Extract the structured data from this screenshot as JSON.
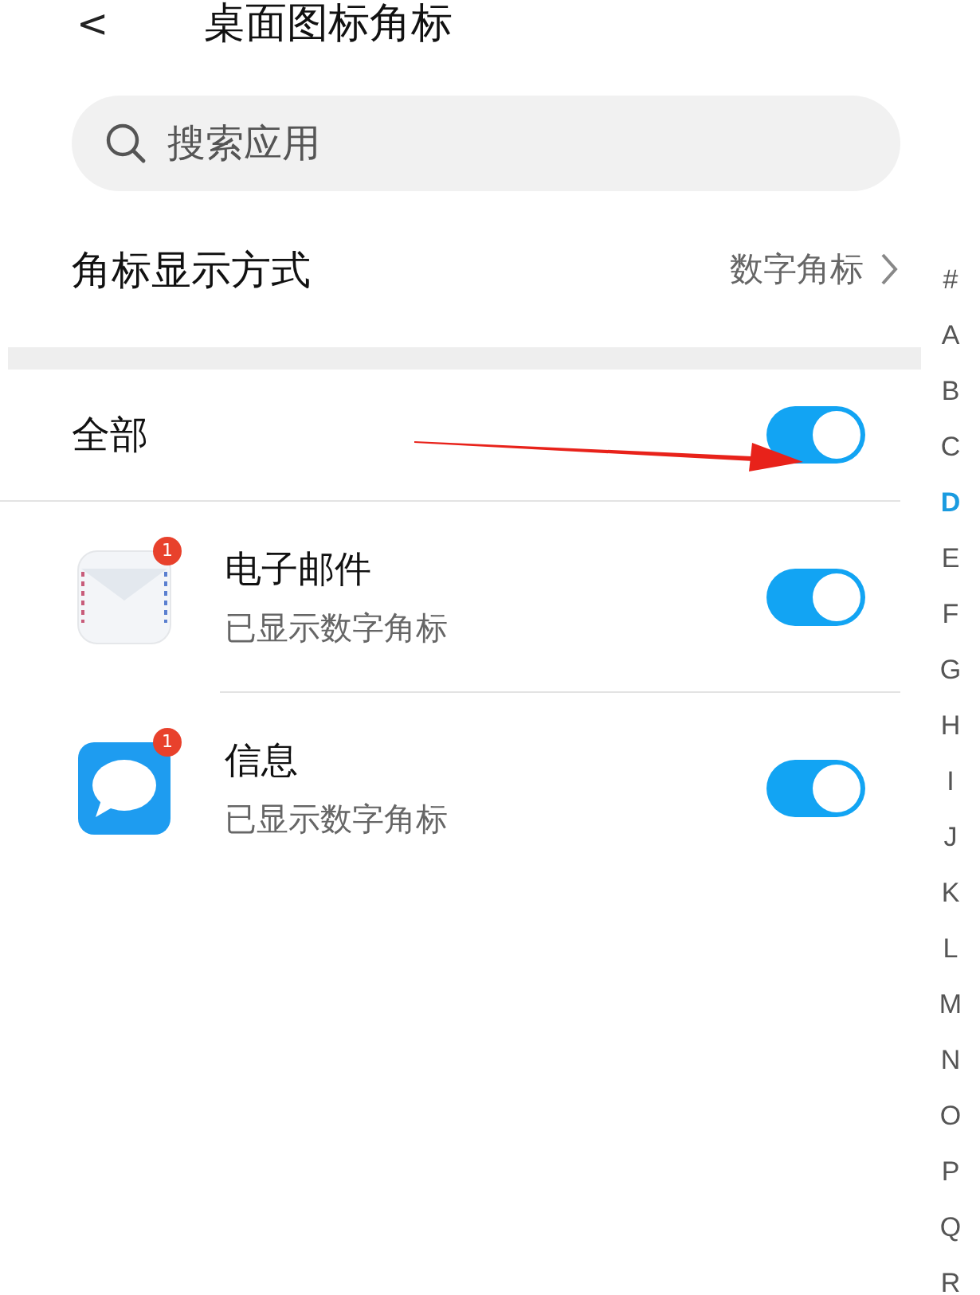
{
  "header": {
    "back": "<",
    "title": "桌面图标角标"
  },
  "search": {
    "placeholder": "搜索应用"
  },
  "badge_style": {
    "label": "角标显示方式",
    "value": "数字角标"
  },
  "all": {
    "label": "全部",
    "on": true
  },
  "apps": [
    {
      "kind": "mail",
      "name": "电子邮件",
      "subtitle": "已显示数字角标",
      "badge": "1",
      "on": true
    },
    {
      "kind": "message",
      "name": "信息",
      "subtitle": "已显示数字角标",
      "badge": "1",
      "on": true
    }
  ],
  "index": [
    {
      "label": "#",
      "selected": false
    },
    {
      "label": "A",
      "selected": false
    },
    {
      "label": "B",
      "selected": false
    },
    {
      "label": "C",
      "selected": false
    },
    {
      "label": "D",
      "selected": true
    },
    {
      "label": "E",
      "selected": false
    },
    {
      "label": "F",
      "selected": false
    },
    {
      "label": "G",
      "selected": false
    },
    {
      "label": "H",
      "selected": false
    },
    {
      "label": "I",
      "selected": false
    },
    {
      "label": "J",
      "selected": false
    },
    {
      "label": "K",
      "selected": false
    },
    {
      "label": "L",
      "selected": false
    },
    {
      "label": "M",
      "selected": false
    },
    {
      "label": "N",
      "selected": false
    },
    {
      "label": "O",
      "selected": false
    },
    {
      "label": "P",
      "selected": false
    },
    {
      "label": "Q",
      "selected": false
    },
    {
      "label": "R",
      "selected": false
    }
  ]
}
